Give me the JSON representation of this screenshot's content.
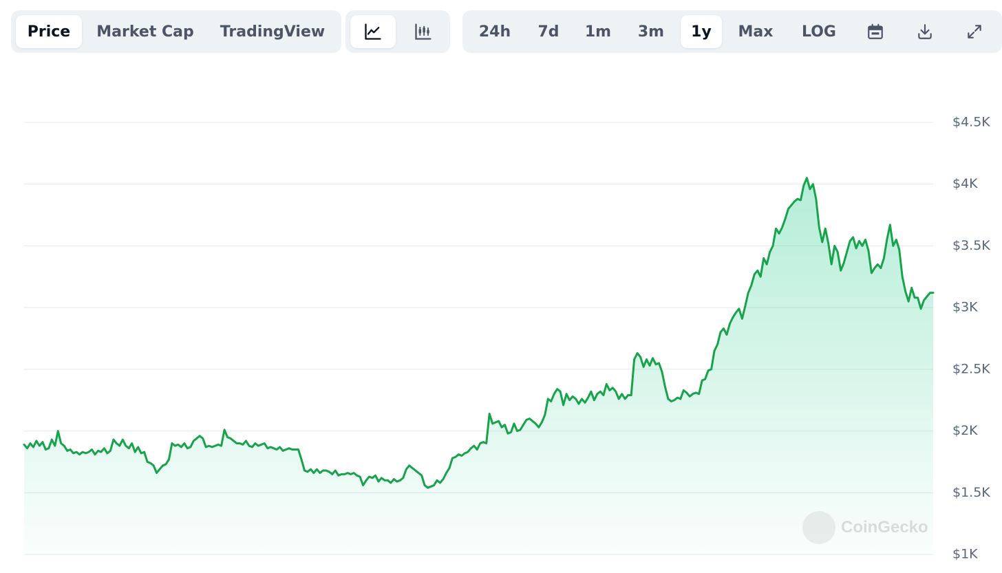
{
  "toolbar": {
    "view_tabs": {
      "price": "Price",
      "market_cap": "Market Cap",
      "tradingview": "TradingView"
    },
    "chart_style": {
      "line_icon": "line-chart-icon",
      "candle_icon": "candlestick-chart-icon"
    },
    "ranges": {
      "r24h": "24h",
      "r7d": "7d",
      "r1m": "1m",
      "r3m": "3m",
      "r1y": "1y",
      "max": "Max",
      "log": "LOG"
    },
    "actions": {
      "calendar_icon": "calendar-icon",
      "download_icon": "download-icon",
      "expand_icon": "expand-icon"
    }
  },
  "watermark": {
    "text": "CoinGecko",
    "logo_icon": "coingecko-logo-icon"
  },
  "colors": {
    "line": "#16a34a",
    "fill_top": "#16c784",
    "grid": "#e6e8ec",
    "accent_bg": "#eff2f5"
  },
  "chart_data": {
    "type": "area",
    "title": "",
    "xlabel": "",
    "ylabel": "",
    "ylim": [
      1000,
      4500
    ],
    "y_axis_position": "right",
    "yticks": [
      1000,
      1500,
      2000,
      2500,
      3000,
      3500,
      4000,
      4500
    ],
    "ytick_labels": [
      "$1K",
      "$1.5K",
      "$2K",
      "$2.5K",
      "$3K",
      "$3.5K",
      "$4K",
      "$4.5K"
    ],
    "grid": true,
    "series": [
      {
        "values": [
          1890,
          1860,
          1900,
          1870,
          1920,
          1880,
          1910,
          1850,
          1860,
          1930,
          1880,
          2000,
          1900,
          1880,
          1840,
          1850,
          1820,
          1830,
          1810,
          1830,
          1820,
          1830,
          1850,
          1810,
          1840,
          1830,
          1860,
          1820,
          1840,
          1930,
          1900,
          1880,
          1930,
          1880,
          1860,
          1900,
          1830,
          1870,
          1820,
          1830,
          1750,
          1740,
          1720,
          1660,
          1690,
          1720,
          1730,
          1770,
          1900,
          1880,
          1890,
          1870,
          1900,
          1860,
          1870,
          1920,
          1940,
          1960,
          1940,
          1870,
          1880,
          1870,
          1880,
          1890,
          1880,
          2010,
          1950,
          1940,
          1920,
          1900,
          1900,
          1890,
          1920,
          1880,
          1870,
          1900,
          1880,
          1890,
          1900,
          1860,
          1870,
          1860,
          1850,
          1870,
          1840,
          1850,
          1860,
          1850,
          1850,
          1850,
          1770,
          1680,
          1670,
          1690,
          1660,
          1690,
          1660,
          1680,
          1680,
          1670,
          1650,
          1680,
          1640,
          1650,
          1650,
          1660,
          1650,
          1660,
          1640,
          1630,
          1560,
          1600,
          1630,
          1620,
          1640,
          1590,
          1620,
          1600,
          1600,
          1580,
          1610,
          1590,
          1600,
          1620,
          1690,
          1720,
          1700,
          1680,
          1660,
          1640,
          1560,
          1540,
          1550,
          1560,
          1600,
          1580,
          1610,
          1660,
          1700,
          1780,
          1790,
          1810,
          1800,
          1820,
          1830,
          1860,
          1880,
          1850,
          1900,
          1910,
          1900,
          2140,
          2060,
          2070,
          2080,
          2030,
          2050,
          1980,
          1990,
          2060,
          2000,
          2010,
          2050,
          2090,
          2100,
          2080,
          2060,
          2030,
          2070,
          2130,
          2260,
          2240,
          2300,
          2340,
          2320,
          2210,
          2300,
          2250,
          2280,
          2260,
          2220,
          2260,
          2230,
          2270,
          2320,
          2250,
          2300,
          2320,
          2290,
          2380,
          2330,
          2350,
          2320,
          2260,
          2300,
          2260,
          2290,
          2290,
          2580,
          2630,
          2600,
          2520,
          2580,
          2530,
          2590,
          2540,
          2550,
          2480,
          2360,
          2260,
          2240,
          2250,
          2270,
          2260,
          2330,
          2310,
          2280,
          2300,
          2310,
          2300,
          2410,
          2420,
          2490,
          2500,
          2650,
          2700,
          2800,
          2830,
          2780,
          2870,
          2920,
          2960,
          2990,
          2910,
          3010,
          3120,
          3180,
          3270,
          3300,
          3250,
          3400,
          3350,
          3450,
          3500,
          3640,
          3600,
          3650,
          3720,
          3800,
          3830,
          3860,
          3880,
          3870,
          3990,
          4050,
          3960,
          4000,
          3880,
          3650,
          3530,
          3640,
          3520,
          3350,
          3500,
          3450,
          3300,
          3360,
          3450,
          3540,
          3570,
          3480,
          3540,
          3500,
          3550,
          3460,
          3280,
          3320,
          3350,
          3320,
          3400,
          3550,
          3670,
          3500,
          3550,
          3470,
          3250,
          3130,
          3050,
          3160,
          3080,
          3080,
          2990,
          3060,
          3090,
          3120,
          3120
        ]
      }
    ]
  }
}
